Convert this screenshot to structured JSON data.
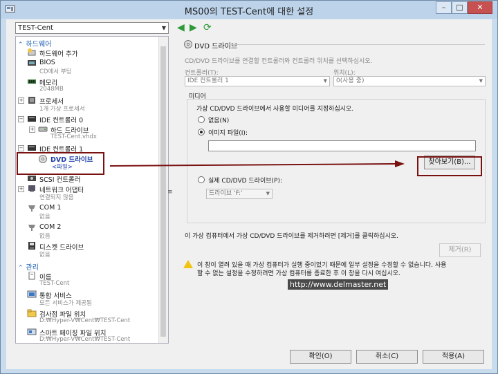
{
  "window": {
    "title": "MS00의 TEST-Cent에 대한 설정",
    "controls": {
      "minimize": "–",
      "maximize": "□",
      "close": "✕"
    }
  },
  "left": {
    "vm_selector": "TEST-Cent",
    "sections": {
      "hardware": "하드웨어",
      "management": "관리"
    },
    "items": {
      "add_hw": {
        "label": "하드웨어 추가"
      },
      "bios": {
        "label": "BIOS",
        "sub": "CD에서 부팅"
      },
      "memory": {
        "label": "메모리",
        "sub": "2048MB"
      },
      "processor": {
        "label": "프로세서",
        "sub": "1개 가상 프로세서"
      },
      "ide0": {
        "label": "IDE 컨트롤러 0"
      },
      "hdd": {
        "label": "하드 드라이브",
        "sub": "TEST-Cent.vhdx"
      },
      "ide1": {
        "label": "IDE 컨트롤러 1"
      },
      "dvd": {
        "label": "DVD 드라이브",
        "sub": "<파일>"
      },
      "scsi": {
        "label": "SCSI 컨트롤러"
      },
      "nic": {
        "label": "네트워크 어댑터",
        "sub": "연결되지 않음"
      },
      "com1": {
        "label": "COM 1",
        "sub": "없음"
      },
      "com2": {
        "label": "COM 2",
        "sub": "없음"
      },
      "floppy": {
        "label": "디스켓 드라이브",
        "sub": "없음"
      },
      "name": {
        "label": "이름",
        "sub": "TEST-Cent"
      },
      "integration": {
        "label": "통합 서비스",
        "sub": "모든 서비스가 제공됨"
      },
      "checkpoint": {
        "label": "검사점 파일 위치",
        "sub": "D:₩Hyper-V₩Cent₩TEST-Cent"
      },
      "paging": {
        "label": "스마트 페이징 파일 위치",
        "sub": "D:₩Hyper-V₩Cent₩TEST-Cent"
      }
    }
  },
  "right": {
    "group_title": "DVD 드라이브",
    "intro": "CD/DVD 드라이브를 연결할 컨트롤러와 컨트롤러 위치를 선택하십시오.",
    "controller_label": "컨트롤러(T):",
    "controller_value": "IDE 컨트롤러 1",
    "location_label": "위치(L):",
    "location_value": "0(사용 중)",
    "media_title": "미디어",
    "media_desc": "가상 CD/DVD 드라이브에서 사용할 미디어를 지정하십시오.",
    "opt_none": "없음(N)",
    "opt_image": "이미지 파일(I):",
    "image_path": "",
    "browse": "찾아보기(B)...",
    "opt_physical": "실제 CD/DVD 드라이브(P):",
    "physical_value": "드라이브 'F:'",
    "remove_hint": "이 가상 컴퓨터에서 가상 CD/DVD 드라이브를 제거하려면 [제거]를 클릭하십시오.",
    "remove": "제거(R)",
    "warning_line1": "이 창이 열려 있을 때 가상 컴퓨터가 실행 중이었기 때문에 일부 설정을 수정할 수 없습니다. 사용",
    "warning_line2": "할 수 없는 설정을 수정하려면 가상 컴퓨터를 종료한 후 이 창을 다시 여십시오."
  },
  "watermark": "http://www.delmaster.net",
  "buttons": {
    "ok": "확인(O)",
    "cancel": "취소(C)",
    "apply": "적용(A)"
  },
  "colors": {
    "selection_highlight": "#3399ff",
    "annotation": "#7a1111",
    "section_heading": "#1b5fb4"
  }
}
